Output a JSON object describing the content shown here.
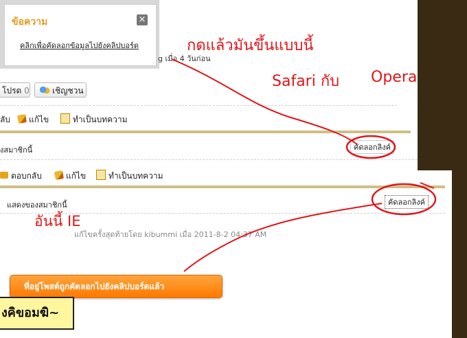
{
  "popup": {
    "title": "ข้อความ",
    "close_icon": "×",
    "link": "คลิกเพื่อคัดลอกข้อมูลไปยังคลิปบอร์ด"
  },
  "top_post": {
    "meta": "g เมื่อ 4 วันก่อน",
    "fav_label": "โปรด",
    "fav_count": "0",
    "invite_label": "เชิญชวน",
    "reply_label": "ลับ",
    "edit_label": "แก้ไข",
    "make_article_label": "ทำเป็นบทความ",
    "member_sig_label": "งสมาชิกนี้",
    "copy_link_label": "คัดลอกลิงค์"
  },
  "bottom_post": {
    "reply_label": "ตอบกลับ",
    "edit_label": "แก้ไข",
    "make_article_label": "ทำเป็นบทความ",
    "member_sig_label": "แสดงของสมาชิกนี้",
    "copy_link_label": "คัดลอกลิงค์",
    "edit_meta": "แก้ไขครั้งสุดท้ายโดย kibummi เมื่อ 2011-8-2 04:37 AM"
  },
  "annotations": {
    "top_note": "กดแล้วมันขึ้นแบบนี้",
    "safari": "Safari กับ",
    "opera": "Opera",
    "ie_note": "อันนี้ IE"
  },
  "toast": "ที่อยู่โพสต์ถูกคัดลอกไปยังคลิปบอร์ดแล้ว",
  "banner_text": "งคิขอมฆิ~",
  "colors": {
    "annotation_red": "#e0151a",
    "toast_orange": "#ff8a00",
    "divider_gold": "#cfbf84",
    "popup_title": "#e39a1b"
  }
}
